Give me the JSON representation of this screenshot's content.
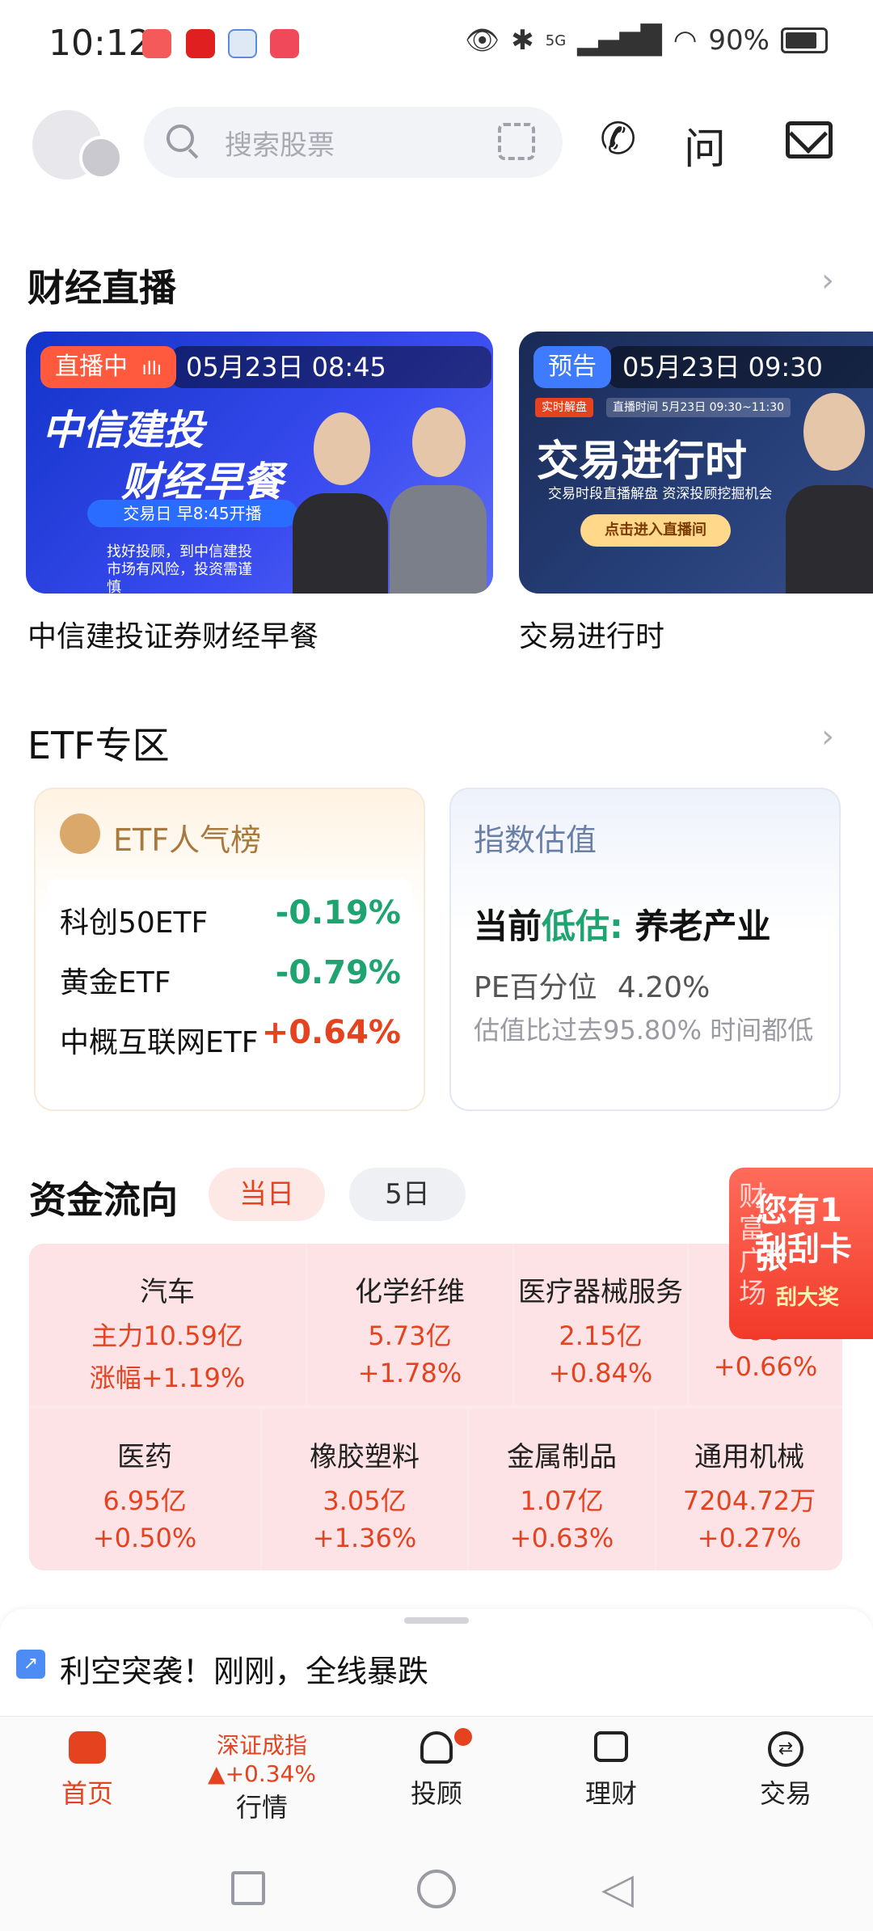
{
  "status_bar": {
    "time": "10:12",
    "battery": "90%",
    "network": "5G"
  },
  "search": {
    "placeholder": "搜索股票"
  },
  "header_icons": {
    "phone": "phone-icon",
    "ask": "问",
    "mail": "mail-icon"
  },
  "live_section": {
    "title": "财经直播",
    "cards": [
      {
        "badge": "直播中",
        "datetime": "05月23日 08:45",
        "main1": "中信建投",
        "main2": "财经早餐",
        "sub": "交易日 早8:45开播",
        "note": "找好投顾，到中信建投 市场有风险，投资需谨慎",
        "caption": "中信建投证券财经早餐"
      },
      {
        "badge": "预告",
        "datetime": "05月23日 09:30",
        "tag": "实时解盘",
        "time_tag": "直播时间  5月23日 09:30~11:30",
        "main": "交易进行时",
        "sub": "交易时段直播解盘 资深投顾挖掘机会",
        "button": "点击进入直播间",
        "caption": "交易进行时"
      }
    ]
  },
  "etf_section": {
    "title": "ETF专区",
    "popular": {
      "title": "ETF人气榜",
      "rows": [
        {
          "name": "科创50ETF",
          "change": "-0.19%"
        },
        {
          "name": "黄金ETF",
          "change": "-0.79%"
        },
        {
          "name": "中概互联网ETF",
          "change": "+0.64%"
        }
      ]
    },
    "valuation": {
      "title": "指数估值",
      "prefix": "当前",
      "status": "低估:",
      "sector": "养老产业",
      "pe_label": "PE百分位",
      "pe_value": "4.20%",
      "note": "估值比过去95.80% 时间都低"
    }
  },
  "flow_section": {
    "title": "资金流向",
    "tabs": [
      "当日",
      "5日"
    ],
    "row1": [
      {
        "name": "汽车",
        "value": "主力10.59亿",
        "change": "涨幅+1.19%"
      },
      {
        "name": "化学纤维",
        "value": "5.73亿",
        "change": "+1.78%"
      },
      {
        "name": "医疗器械服务",
        "value": "2.15亿",
        "change": "+0.84%"
      },
      {
        "name": "化",
        "value": "96",
        "change": "+0.66%"
      }
    ],
    "row2": [
      {
        "name": "医药",
        "value": "6.95亿",
        "change": "+0.50%"
      },
      {
        "name": "橡胶塑料",
        "value": "3.05亿",
        "change": "+1.36%"
      },
      {
        "name": "金属制品",
        "value": "1.07亿",
        "change": "+0.63%"
      },
      {
        "name": "通用机械",
        "value": "7204.72万",
        "change": "+0.27%"
      }
    ]
  },
  "float_ad": {
    "line1": "您有1张",
    "line2": "刮刮卡",
    "line3": "刮大奖",
    "side": "财富广场"
  },
  "news": {
    "text": "利空突袭！刚刚，全线暴跌"
  },
  "bottom_nav": {
    "home": "首页",
    "index_name": "深证成指",
    "index_change": "+0.34%",
    "market": "行情",
    "advisor": "投顾",
    "wealth": "理财",
    "trade": "交易"
  },
  "colors": {
    "accent": "#e5421f",
    "green": "#1ea470",
    "blue_live": "#2f45e0"
  }
}
